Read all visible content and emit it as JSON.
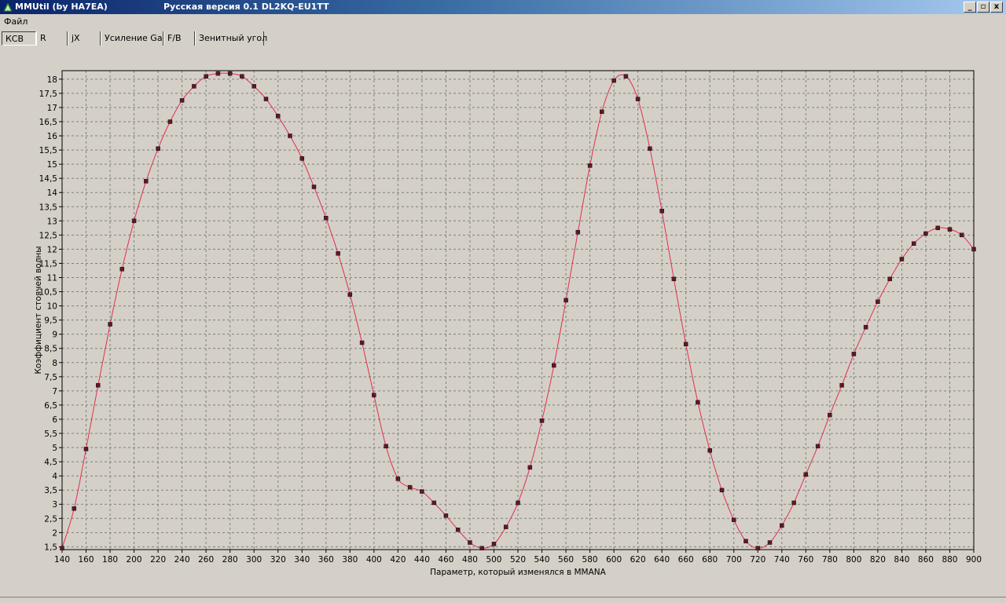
{
  "window": {
    "title": "MMUtil (by HA7EA)",
    "subtitle": "Русская версия 0.1 DL2KQ-EU1TT",
    "buttons": [
      "_",
      "▫",
      "x"
    ]
  },
  "menu": {
    "file_label": "Файл"
  },
  "tabs": [
    {
      "label": "КСВ",
      "active": true
    },
    {
      "label": "R",
      "active": false
    },
    {
      "label": "jX",
      "active": false
    },
    {
      "label": "Усиление Ga",
      "active": false
    },
    {
      "label": "F/B",
      "active": false
    },
    {
      "label": "Зенитный угол",
      "active": false
    }
  ],
  "colors": {
    "line": "#e0304a",
    "marker": "#5a1a2a",
    "grid": "#808080",
    "background": "#d4d0c8"
  },
  "chart_data": {
    "type": "line",
    "title": "",
    "xlabel": "Параметр, который изменялся в MMANA",
    "ylabel": "Коэффициент стоячей волны",
    "xlim": [
      140,
      900
    ],
    "ylim": [
      1.4,
      18.3
    ],
    "grid": true,
    "x_ticks": [
      140,
      160,
      180,
      200,
      220,
      240,
      260,
      280,
      300,
      320,
      340,
      360,
      380,
      400,
      420,
      440,
      460,
      480,
      500,
      520,
      540,
      560,
      580,
      600,
      620,
      640,
      660,
      680,
      700,
      720,
      740,
      760,
      780,
      800,
      820,
      840,
      860,
      880,
      900
    ],
    "y_ticks": [
      "1,5",
      "2",
      "2,5",
      "3",
      "3,5",
      "4",
      "4,5",
      "5",
      "5,5",
      "6",
      "6,5",
      "7",
      "7,5",
      "8",
      "8,5",
      "9",
      "9,5",
      "10",
      "10,5",
      "11",
      "11,5",
      "12",
      "12,5",
      "13",
      "13,5",
      "14",
      "14,5",
      "15",
      "15,5",
      "16",
      "16,5",
      "17",
      "17,5",
      "18"
    ],
    "y_tick_values": [
      1.5,
      2,
      2.5,
      3,
      3.5,
      4,
      4.5,
      5,
      5.5,
      6,
      6.5,
      7,
      7.5,
      8,
      8.5,
      9,
      9.5,
      10,
      10.5,
      11,
      11.5,
      12,
      12.5,
      13,
      13.5,
      14,
      14.5,
      15,
      15.5,
      16,
      16.5,
      17,
      17.5,
      18
    ],
    "series": [
      {
        "x": [
          140,
          150,
          160,
          170,
          180,
          190,
          200,
          210,
          220,
          230,
          240,
          250,
          260,
          270,
          280,
          290,
          300,
          310,
          320,
          330,
          340,
          350,
          360,
          370,
          380,
          390,
          400,
          410,
          420,
          430,
          440,
          450,
          460,
          470,
          480,
          490,
          500,
          510,
          520,
          530,
          540,
          550,
          560,
          570,
          580,
          590,
          600,
          610,
          620,
          630,
          640,
          650,
          660,
          670,
          680,
          690,
          700,
          710,
          720,
          730,
          740,
          750,
          760,
          770,
          780,
          790,
          800,
          810,
          820,
          830,
          840,
          850,
          860,
          870,
          880,
          890,
          900
        ],
        "y": [
          1.45,
          2.85,
          4.95,
          7.2,
          9.35,
          11.3,
          13.0,
          14.4,
          15.55,
          16.5,
          17.25,
          17.75,
          18.1,
          18.2,
          18.2,
          18.1,
          17.75,
          17.3,
          16.7,
          16.0,
          15.2,
          14.2,
          13.1,
          11.85,
          10.4,
          8.7,
          6.85,
          5.05,
          3.9,
          3.6,
          3.45,
          3.05,
          2.6,
          2.1,
          1.65,
          1.45,
          1.6,
          2.2,
          3.05,
          4.3,
          5.95,
          7.9,
          10.2,
          12.6,
          14.95,
          16.85,
          17.95,
          18.1,
          17.3,
          15.55,
          13.35,
          10.95,
          8.65,
          6.6,
          4.9,
          3.5,
          2.45,
          1.7,
          1.45,
          1.65,
          2.25,
          3.05,
          4.05,
          5.05,
          6.15,
          7.2,
          8.3,
          9.25,
          10.15,
          10.95,
          11.65,
          12.2,
          12.55,
          12.75,
          12.7,
          12.5,
          12.0
        ]
      }
    ]
  }
}
